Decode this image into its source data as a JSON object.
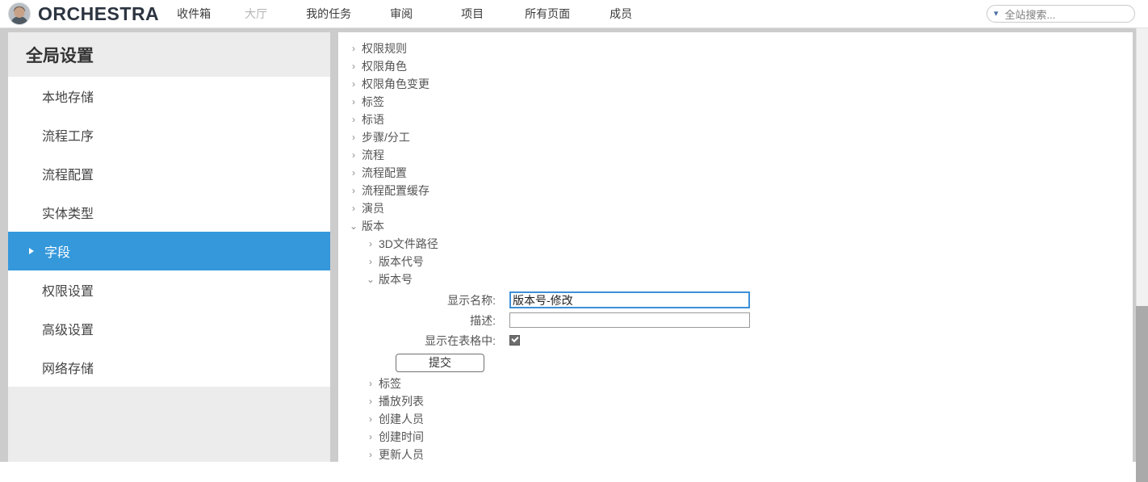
{
  "topbar": {
    "brand": "ORCHESTRA",
    "avatar_icon": "user-avatar",
    "nav": [
      {
        "label": "收件箱",
        "muted": false
      },
      {
        "label": "大厅",
        "muted": true
      },
      {
        "label": "我的任务",
        "muted": false
      },
      {
        "label": "审阅",
        "muted": false
      },
      {
        "label": "项目",
        "muted": false
      },
      {
        "label": "所有页面",
        "muted": false
      },
      {
        "label": "成员",
        "muted": false
      }
    ],
    "search": {
      "placeholder": "全站搜索...",
      "value": "",
      "chevron_icon": "chevron-down-icon"
    }
  },
  "sidebar": {
    "title": "全局设置",
    "items": [
      {
        "label": "本地存储",
        "active": false
      },
      {
        "label": "流程工序",
        "active": false
      },
      {
        "label": "流程配置",
        "active": false
      },
      {
        "label": "实体类型",
        "active": false
      },
      {
        "label": "字段",
        "active": true
      },
      {
        "label": "权限设置",
        "active": false
      },
      {
        "label": "高级设置",
        "active": false
      },
      {
        "label": "网络存储",
        "active": false
      }
    ],
    "active_arrow_icon": "triangle-right-icon"
  },
  "tree": {
    "collapsed_icon": "chevron-right-icon",
    "expanded_icon": "chevron-down-icon",
    "nodes": [
      {
        "label": "权限规则",
        "level": 1,
        "expanded": false
      },
      {
        "label": "权限角色",
        "level": 1,
        "expanded": false
      },
      {
        "label": "权限角色变更",
        "level": 1,
        "expanded": false
      },
      {
        "label": "标签",
        "level": 1,
        "expanded": false
      },
      {
        "label": "标语",
        "level": 1,
        "expanded": false
      },
      {
        "label": "步骤/分工",
        "level": 1,
        "expanded": false
      },
      {
        "label": "流程",
        "level": 1,
        "expanded": false
      },
      {
        "label": "流程配置",
        "level": 1,
        "expanded": false
      },
      {
        "label": "流程配置缓存",
        "level": 1,
        "expanded": false
      },
      {
        "label": "演员",
        "level": 1,
        "expanded": false
      },
      {
        "label": "版本",
        "level": 1,
        "expanded": true
      }
    ],
    "children": [
      {
        "label": "3D文件路径",
        "level": 2,
        "expanded": false
      },
      {
        "label": "版本代号",
        "level": 2,
        "expanded": false
      },
      {
        "label": "版本号",
        "level": 2,
        "expanded": true
      }
    ],
    "nodes_after": [
      {
        "label": "标签",
        "level": 2,
        "expanded": false
      },
      {
        "label": "播放列表",
        "level": 2,
        "expanded": false
      },
      {
        "label": "创建人员",
        "level": 2,
        "expanded": false
      },
      {
        "label": "创建时间",
        "level": 2,
        "expanded": false
      },
      {
        "label": "更新人员",
        "level": 2,
        "expanded": false
      }
    ]
  },
  "form": {
    "display_name_label": "显示名称:",
    "display_name_value": "版本号-修改",
    "description_label": "描述:",
    "description_value": "",
    "show_in_table_label": "显示在表格中:",
    "show_in_table_checked": true,
    "submit_label": "提交"
  },
  "colors": {
    "accent": "#3498db",
    "focus_border": "#3d8fd6",
    "page_bg": "#cccccc",
    "panel_bg": "#ffffff",
    "sidebar_header_bg": "#ececec"
  }
}
